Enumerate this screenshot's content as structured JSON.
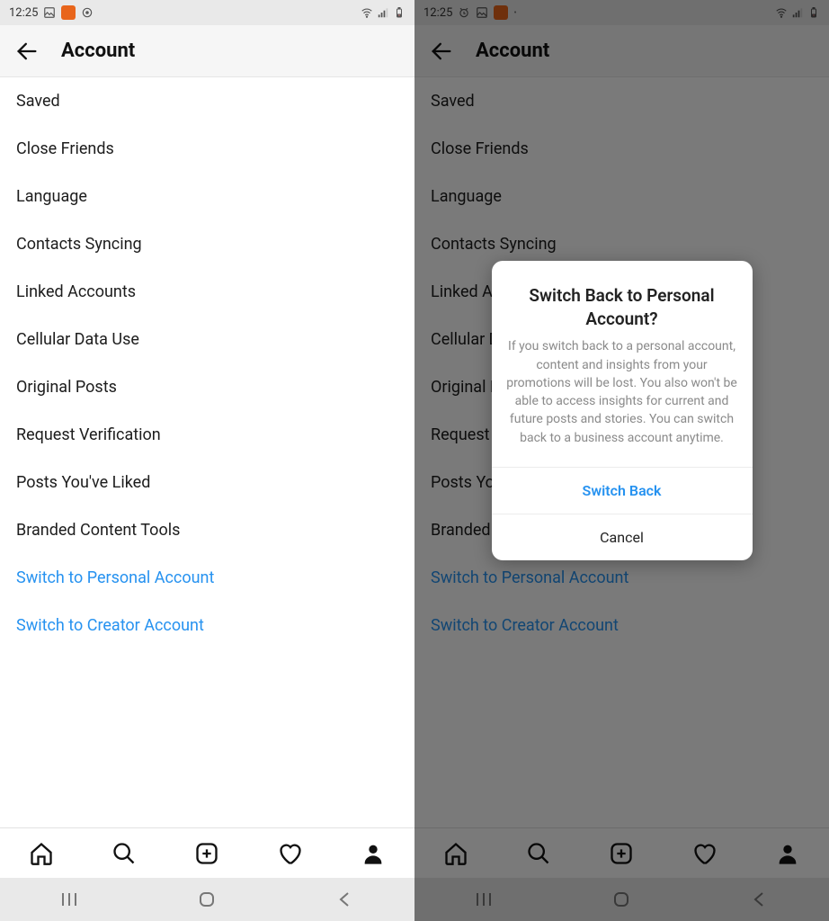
{
  "status": {
    "time": "12:25"
  },
  "header": {
    "title": "Account"
  },
  "menu": {
    "saved": "Saved",
    "closeFriends": "Close Friends",
    "language": "Language",
    "contactsSyncing": "Contacts Syncing",
    "linkedAccounts": "Linked Accounts",
    "cellularDataUse": "Cellular Data Use",
    "originalPosts": "Original Posts",
    "requestVerification": "Request Verification",
    "postsLiked": "Posts You've Liked",
    "brandedContent": "Branded Content Tools",
    "switchPersonal": "Switch to Personal Account",
    "switchCreator": "Switch to Creator Account"
  },
  "dialog": {
    "title": "Switch Back to Personal Account?",
    "body": "If you switch back to a personal account, content and insights from your promotions will be lost. You also won't be able to access insights for current and future posts and stories. You can switch back to a business account anytime.",
    "primary": "Switch Back",
    "cancel": "Cancel"
  }
}
